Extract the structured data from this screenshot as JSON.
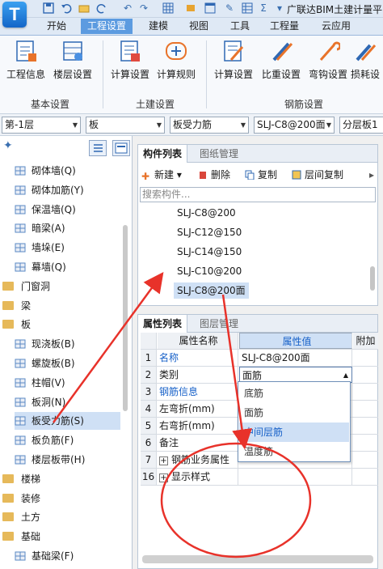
{
  "app": {
    "logo": "T",
    "title": "广联达BIM土建计量平"
  },
  "quick_access": [
    "save-icon",
    "undo-icon",
    "redo-icon",
    "new-file-icon",
    "open-folder-icon"
  ],
  "menu": {
    "tabs": [
      "开始",
      "工程设置",
      "建模",
      "视图",
      "工具",
      "工程量",
      "云应用"
    ],
    "active": "工程设置"
  },
  "ribbon": {
    "buttons": [
      {
        "label": "工程信息",
        "icon": "project-info-icon"
      },
      {
        "label": "楼层设置",
        "icon": "floor-settings-icon"
      },
      {
        "label": "计算设置",
        "icon": "calc-settings-icon"
      },
      {
        "label": "计算规则",
        "icon": "calc-rules-icon"
      },
      {
        "label": "计算设置",
        "icon": "rebar-calc-settings-icon"
      },
      {
        "label": "比重设置",
        "icon": "density-settings-icon"
      },
      {
        "label": "弯钩设置",
        "icon": "hook-settings-icon"
      },
      {
        "label": "损耗设",
        "icon": "loss-settings-icon"
      }
    ],
    "groups": [
      "基本设置",
      "土建设置",
      "钢筋设置"
    ]
  },
  "selectors": {
    "floor": "第-1层",
    "category": "板",
    "type": "板受力筋",
    "component": "SLJ-C8@200面",
    "sub": "分层板1"
  },
  "tree": {
    "items": [
      {
        "label": "砌体墙(Q)",
        "kind": "item"
      },
      {
        "label": "砌体加筋(Y)",
        "kind": "item"
      },
      {
        "label": "保温墙(Q)",
        "kind": "item"
      },
      {
        "label": "暗梁(A)",
        "kind": "item"
      },
      {
        "label": "墙垛(E)",
        "kind": "item"
      },
      {
        "label": "幕墙(Q)",
        "kind": "item"
      },
      {
        "label": "门窗洞",
        "kind": "folder"
      },
      {
        "label": "梁",
        "kind": "folder"
      },
      {
        "label": "板",
        "kind": "folder"
      },
      {
        "label": "现浇板(B)",
        "kind": "item"
      },
      {
        "label": "螺旋板(B)",
        "kind": "item"
      },
      {
        "label": "柱帽(V)",
        "kind": "item"
      },
      {
        "label": "板洞(N)",
        "kind": "item"
      },
      {
        "label": "板受力筋(S)",
        "kind": "item",
        "selected": true
      },
      {
        "label": "板负筋(F)",
        "kind": "item"
      },
      {
        "label": "楼层板带(H)",
        "kind": "item"
      },
      {
        "label": "楼梯",
        "kind": "folder"
      },
      {
        "label": "装修",
        "kind": "folder"
      },
      {
        "label": "土方",
        "kind": "folder"
      },
      {
        "label": "基础",
        "kind": "folder"
      },
      {
        "label": "基础梁(F)",
        "kind": "item"
      }
    ]
  },
  "component_panel": {
    "tabs": [
      "构件列表",
      "图纸管理"
    ],
    "toolbar": {
      "new": "新建",
      "delete": "删除",
      "copy": "复制",
      "floor_copy": "层间复制"
    },
    "search_placeholder": "搜索构件...",
    "items": [
      "SLJ-C8@200",
      "SLJ-C12@150",
      "SLJ-C14@150",
      "SLJ-C10@200",
      "SLJ-C8@200面"
    ],
    "selected": "SLJ-C8@200面"
  },
  "property_panel": {
    "tabs": [
      "属性列表",
      "图层管理"
    ],
    "headers": {
      "name": "属性名称",
      "value": "属性值",
      "extra": "附加"
    },
    "rows": [
      {
        "num": "1",
        "name": "名称",
        "value": "SLJ-C8@200面",
        "blue": true,
        "check": false
      },
      {
        "num": "2",
        "name": "类别",
        "value": "面筋",
        "blue": false,
        "check": true
      },
      {
        "num": "3",
        "name": "钢筋信息",
        "value": "",
        "blue": true,
        "check": true
      },
      {
        "num": "4",
        "name": "左弯折(mm)",
        "value": "",
        "blue": false,
        "check": true
      },
      {
        "num": "5",
        "name": "右弯折(mm)",
        "value": "",
        "blue": false,
        "check": true
      },
      {
        "num": "6",
        "name": "备注",
        "value": "",
        "blue": false,
        "check": true
      },
      {
        "num": "7",
        "name": "钢筋业务属性",
        "value": "",
        "blue": false,
        "check": false,
        "expand": true
      },
      {
        "num": "16",
        "name": "显示样式",
        "value": "",
        "blue": false,
        "check": false,
        "expand": true
      }
    ],
    "dropdown_options": [
      "底筋",
      "面筋",
      "中间层筋",
      "温度筋"
    ],
    "dropdown_highlight": "中间层筋"
  },
  "colors": {
    "accent": "#5c9be0",
    "annotation": "#e8322a",
    "selected": "#cfe0f5"
  }
}
